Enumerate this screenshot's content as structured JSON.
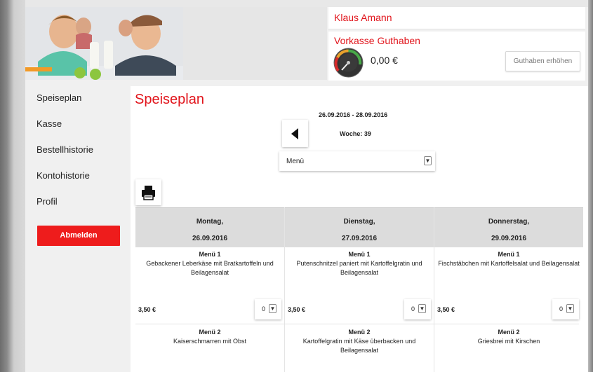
{
  "user": {
    "name": "Klaus Amann"
  },
  "credit": {
    "title": "Vorkasse Guthaben",
    "amount": "0,00 €",
    "topup_label": "Guthaben erhöhen"
  },
  "sidebar": {
    "items": [
      {
        "label": "Speiseplan"
      },
      {
        "label": "Kasse"
      },
      {
        "label": "Bestellhistorie"
      },
      {
        "label": "Kontohistorie"
      },
      {
        "label": "Profil"
      }
    ],
    "logout_label": "Abmelden"
  },
  "main": {
    "title": "Speiseplan",
    "date_range": "26.09.2016 - 28.09.2016",
    "week": "Woche: 39",
    "menu_select": {
      "value": "Menü"
    },
    "days": [
      {
        "name": "Montag,",
        "date": "26.09.2016",
        "menus": [
          {
            "title": "Menü 1",
            "desc": "Gebackener Leberkäse mit Bratkartoffeln und Beilagensalat",
            "price": "3,50 €",
            "qty": "0"
          },
          {
            "title": "Menü 2",
            "desc": "Kaiserschmarren mit Obst"
          }
        ]
      },
      {
        "name": "Dienstag,",
        "date": "27.09.2016",
        "menus": [
          {
            "title": "Menü 1",
            "desc": "Putenschnitzel paniert mit Kartoffelgratin und Beilagensalat",
            "price": "3,50 €",
            "qty": "0"
          },
          {
            "title": "Menü 2",
            "desc": "Kartoffelgratin mit Käse überbacken und Beilagensalat"
          }
        ]
      },
      {
        "name": "Donnerstag,",
        "date": "29.09.2016",
        "menus": [
          {
            "title": "Menü 1",
            "desc": "Fischstäbchen mit Kartoffelsalat und Beilagensalat",
            "price": "3,50 €",
            "qty": "0"
          },
          {
            "title": "Menü 2",
            "desc": "Griesbrei mit Kirschen"
          }
        ]
      }
    ]
  },
  "icons": {
    "prev": "triangle-left-icon",
    "print": "printer-icon",
    "dropdown": "chevron-down-icon",
    "gauge": "gauge-icon"
  },
  "colors": {
    "accent": "#e1141b",
    "logout": "#ee1c1c",
    "table_header": "#dcdcdc"
  }
}
